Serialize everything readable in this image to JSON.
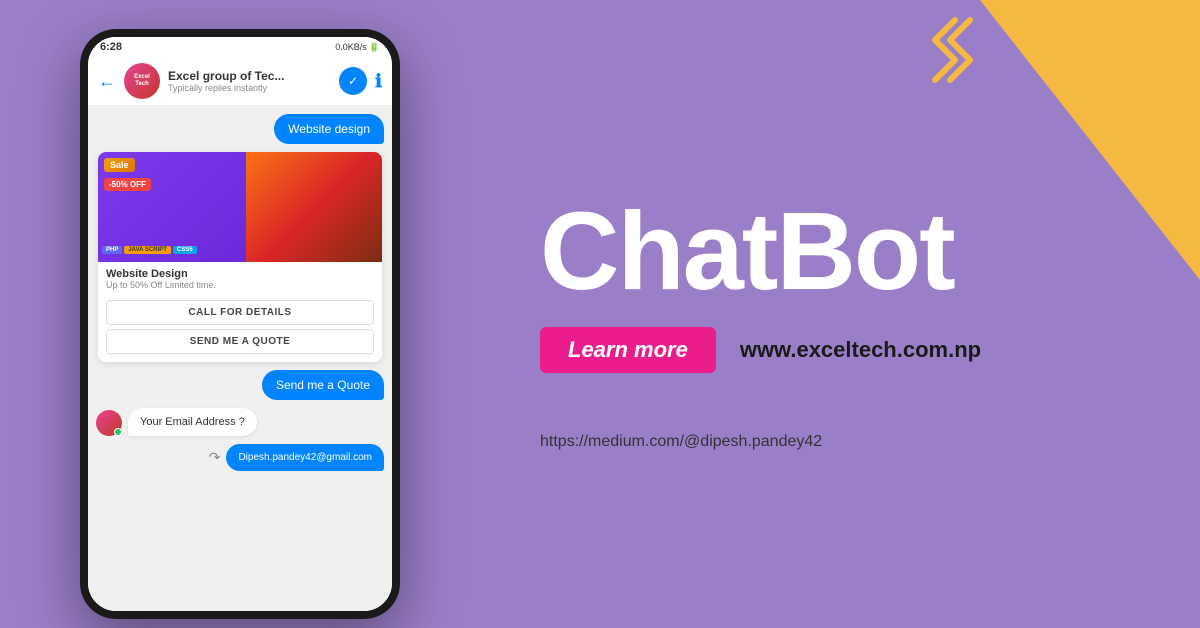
{
  "background": {
    "color": "#9b7ec8"
  },
  "decorative": {
    "triangle_color": "#f5b942",
    "squiggle_color": "#f5b942"
  },
  "phone": {
    "status_bar": {
      "time": "6:28",
      "network": "0.0KB/s",
      "signal": "..."
    },
    "chat_header": {
      "name": "Excel group of Tec...",
      "status": "Typically replies instantly"
    },
    "messages": [
      {
        "type": "sent",
        "text": "Website design"
      },
      {
        "type": "product_card",
        "title": "Website Design",
        "subtitle": "Up to 50% Off Limited time.",
        "action1": "CALL FOR DETAILS",
        "action2": "SEND ME A QUOTE"
      },
      {
        "type": "sent",
        "text": "Send me a Quote"
      },
      {
        "type": "received",
        "text": "Your Email Address ?"
      },
      {
        "type": "sent",
        "text": "Dipesh.pandey42@gmail.com"
      }
    ],
    "sale_label": "Sale",
    "discount_label": "-50% OFF",
    "php_label": "PHP",
    "js_label": "JAVA SCRIPT",
    "css_label": "CSS5"
  },
  "right": {
    "title": "ChatBot",
    "learn_more_label": "Learn more",
    "website_url": "www.exceltech.com.np",
    "medium_url": "https://medium.com/@dipesh.pandey42"
  }
}
